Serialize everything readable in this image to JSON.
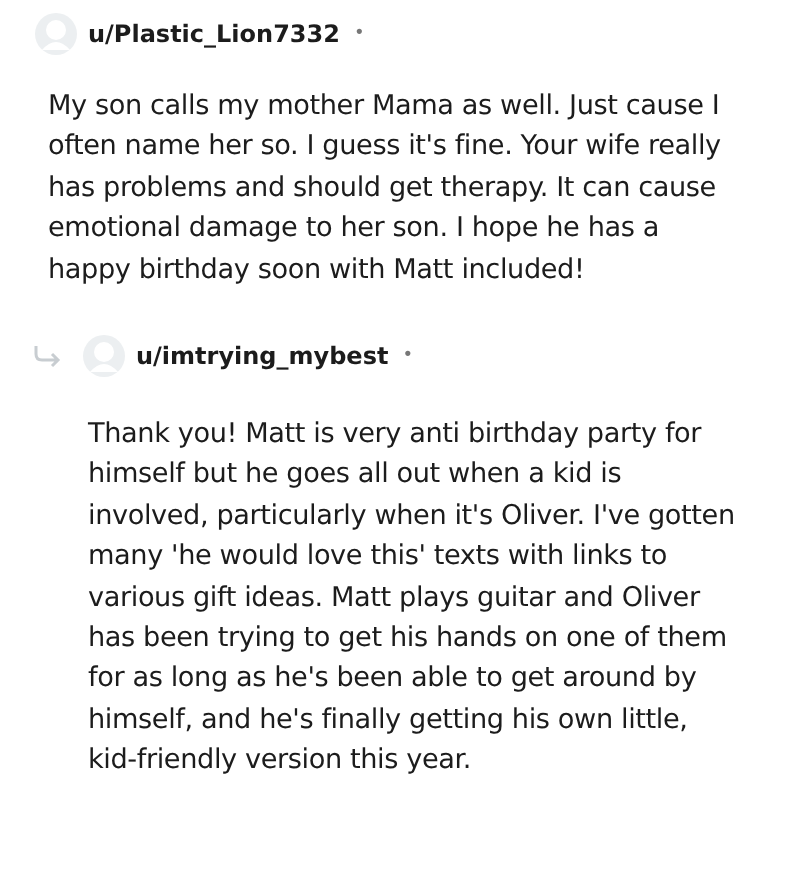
{
  "comments": [
    {
      "username": "u/Plastic_Lion7332",
      "separator": "•",
      "reply": false,
      "body": "My son calls my mother Mama as well. Just cause I often name her so. I guess it's fine. Your wife really has problems and should get therapy. It can cause emotional damage to her son. I hope he has a happy birthday soon with Matt included!"
    },
    {
      "username": "u/imtrying_mybest",
      "separator": "•",
      "reply": true,
      "body": "Thank you! Matt is very anti birthday party for himself but he goes all out when a kid is involved, particularly when it's Oliver. I've gotten many 'he would love this' texts with links to various gift ideas. Matt plays guitar and Oliver has been trying to get his hands on one of them for as long as he's been able to get around by himself, and he's finally getting his own little, kid-friendly version this year."
    }
  ]
}
